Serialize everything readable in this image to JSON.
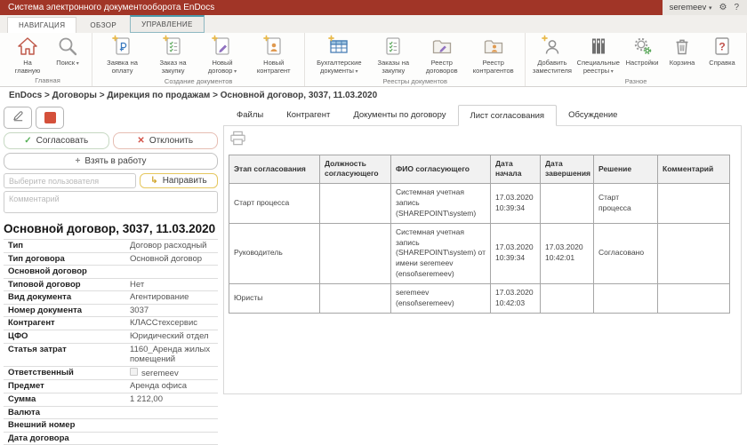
{
  "titlebar": {
    "app_title": "Система электронного документооборота EnDocs",
    "user_label": "seremeev",
    "icons": {
      "user_caret": "▾",
      "gear": "⚙",
      "help": "?"
    }
  },
  "ribbon_tabs": [
    {
      "label": "НАВИГАЦИЯ",
      "state": "active"
    },
    {
      "label": "ОБЗОР",
      "state": "normal"
    },
    {
      "label": "УПРАВЛЕНИЕ",
      "state": "highlighted"
    }
  ],
  "ribbon": {
    "groups": [
      {
        "label": "Главная",
        "buttons": [
          {
            "label": "На главную",
            "icon": "home-icon"
          },
          {
            "label": "Поиск",
            "icon": "search-icon",
            "dropdown": true
          }
        ]
      },
      {
        "label": "Создание документов",
        "buttons": [
          {
            "label": "Заявка на оплату",
            "icon": "payment-request-icon"
          },
          {
            "label": "Заказ на закупку",
            "icon": "purchase-order-icon"
          },
          {
            "label": "Новый договор",
            "icon": "new-contract-icon",
            "dropdown": true
          },
          {
            "label": "Новый контрагент",
            "icon": "new-counterparty-icon"
          }
        ]
      },
      {
        "label": "Реестры документов",
        "buttons": [
          {
            "label": "Бухгалтерские документы",
            "icon": "accounting-docs-icon",
            "dropdown": true
          },
          {
            "label": "Заказы на закупку",
            "icon": "purchase-orders-icon"
          },
          {
            "label": "Реестр договоров",
            "icon": "contracts-registry-icon"
          },
          {
            "label": "Реестр контрагентов",
            "icon": "counterparties-registry-icon"
          }
        ]
      },
      {
        "label": "Разное",
        "buttons": [
          {
            "label": "Добавить заместителя",
            "icon": "add-deputy-icon"
          },
          {
            "label": "Специальные реестры",
            "icon": "special-registries-icon",
            "dropdown": true
          },
          {
            "label": "Настройки",
            "icon": "settings-gears-icon"
          },
          {
            "label": "Корзина",
            "icon": "trash-icon"
          },
          {
            "label": "Справка",
            "icon": "help-book-icon"
          }
        ]
      }
    ]
  },
  "breadcrumb": {
    "separator": ">",
    "items": [
      "EnDocs",
      "Договоры",
      "Дирекция по продажам",
      "Основной договор, 3037, 11.03.2020"
    ]
  },
  "actions": {
    "approve": "Согласовать",
    "approve_icon": "✓",
    "reject": "Отклонить",
    "reject_icon": "✕",
    "take": "Взять в работу",
    "take_icon": "+",
    "route": "Направить",
    "route_icon": "↳",
    "user_placeholder": "Выберите пользователя",
    "comment_placeholder": "Комментарий"
  },
  "document": {
    "title": "Основной договор, 3037, 11.03.2020",
    "properties": [
      {
        "label": "Тип",
        "value": "Договор расходный"
      },
      {
        "label": "Тип договора",
        "value": "Основной договор"
      },
      {
        "label": "Основной договор",
        "value": ""
      },
      {
        "label": "Типовой договор",
        "value": "Нет"
      },
      {
        "label": "Вид документа",
        "value": "Агентирование"
      },
      {
        "label": "Номер документа",
        "value": "3037"
      },
      {
        "label": "Контрагент",
        "value": "КЛАССтехсервис"
      },
      {
        "label": "ЦФО",
        "value": "Юридический отдел"
      },
      {
        "label": "Статья затрат",
        "value": "1160_Аренда жилых помещений"
      },
      {
        "label": "Ответственный",
        "value": "seremeev",
        "checkbox": true
      },
      {
        "label": "Предмет",
        "value": "Аренда офиса"
      },
      {
        "label": "Сумма",
        "value": "1 212,00"
      },
      {
        "label": "Валюта",
        "value": ""
      },
      {
        "label": "Внешний номер",
        "value": ""
      },
      {
        "label": "Дата договора",
        "value": ""
      }
    ]
  },
  "panel": {
    "tabs": [
      "Файлы",
      "Контрагент",
      "Документы по договору",
      "Лист согласования",
      "Обсуждение"
    ],
    "active_tab": "Лист согласования"
  },
  "approval_table": {
    "headers": [
      "Этап согласования",
      "Должность согласующего",
      "ФИО согласующего",
      "Дата начала",
      "Дата завершения",
      "Решение",
      "Комментарий"
    ],
    "rows": [
      [
        "Старт процесса",
        "",
        "Системная учетная запись (SHAREPOINT\\system)",
        "17.03.2020 10:39:34",
        "",
        "Старт процесса",
        ""
      ],
      [
        "Руководитель",
        "",
        "Системная учетная запись (SHAREPOINT\\system) от имени seremeev (ensol\\seremeev)",
        "17.03.2020 10:39:34",
        "17.03.2020 10:42:01",
        "Согласовано",
        ""
      ],
      [
        "Юристы",
        "",
        "seremeev (ensol\\seremeev)",
        "17.03.2020 10:42:03",
        "",
        "",
        ""
      ]
    ]
  }
}
